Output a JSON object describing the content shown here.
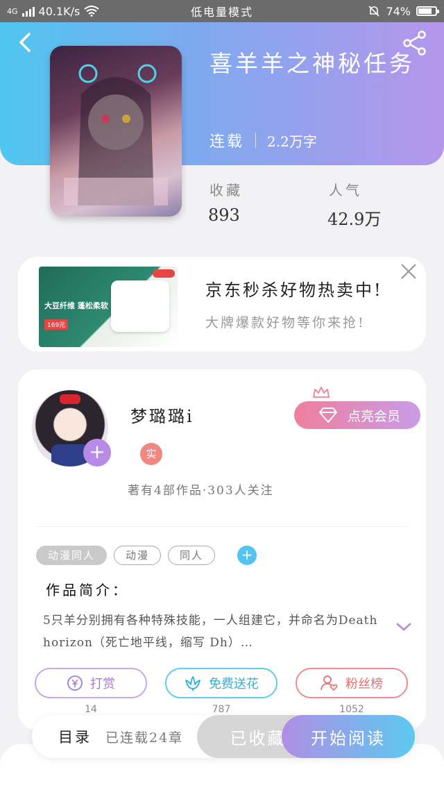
{
  "status_bar": {
    "network": "4G",
    "speed": "40.1K/s",
    "mode": "低电量模式",
    "battery": "74%"
  },
  "book": {
    "title": "喜羊羊之神秘任务",
    "status": "连载",
    "word_count": "2.2万字",
    "favorites_label": "收藏",
    "favorites_value": "893",
    "popularity_label": "人气",
    "popularity_value": "42.9万"
  },
  "ad": {
    "title": "京东秒杀好物热卖中!",
    "subtitle": "大牌爆款好物等你来抢!"
  },
  "author": {
    "name": "梦璐璐i",
    "verified_badge": "实",
    "info": "著有4部作品·303人关注",
    "follow_symbol": "+",
    "vip_button": "点亮会员"
  },
  "tags": [
    {
      "label": "动漫同人",
      "style": "filled"
    },
    {
      "label": "动漫",
      "style": "outline"
    },
    {
      "label": "同人",
      "style": "outline"
    }
  ],
  "tag_add_symbol": "+",
  "intro": {
    "label": "作品简介：",
    "text": "5只羊分别拥有各种特殊技能，一人组建它，并命名为Death horizon（死亡地平线，缩写 Dh）…"
  },
  "actions": {
    "reward": {
      "label": "打赏",
      "count": "14"
    },
    "flower": {
      "label": "免费送花",
      "count": "787"
    },
    "fans": {
      "label": "粉丝榜",
      "count": "1052"
    }
  },
  "bottom": {
    "toc_label": "目录",
    "toc_status": "已连载24章",
    "fav_button": "已收藏",
    "read_button": "开始阅读"
  },
  "colors": {
    "header_start": "#4fc6f0",
    "header_end": "#b596ea",
    "accent_purple": "#b68ae6",
    "accent_blue": "#5cc9ef",
    "accent_red": "#ef8b8b"
  }
}
